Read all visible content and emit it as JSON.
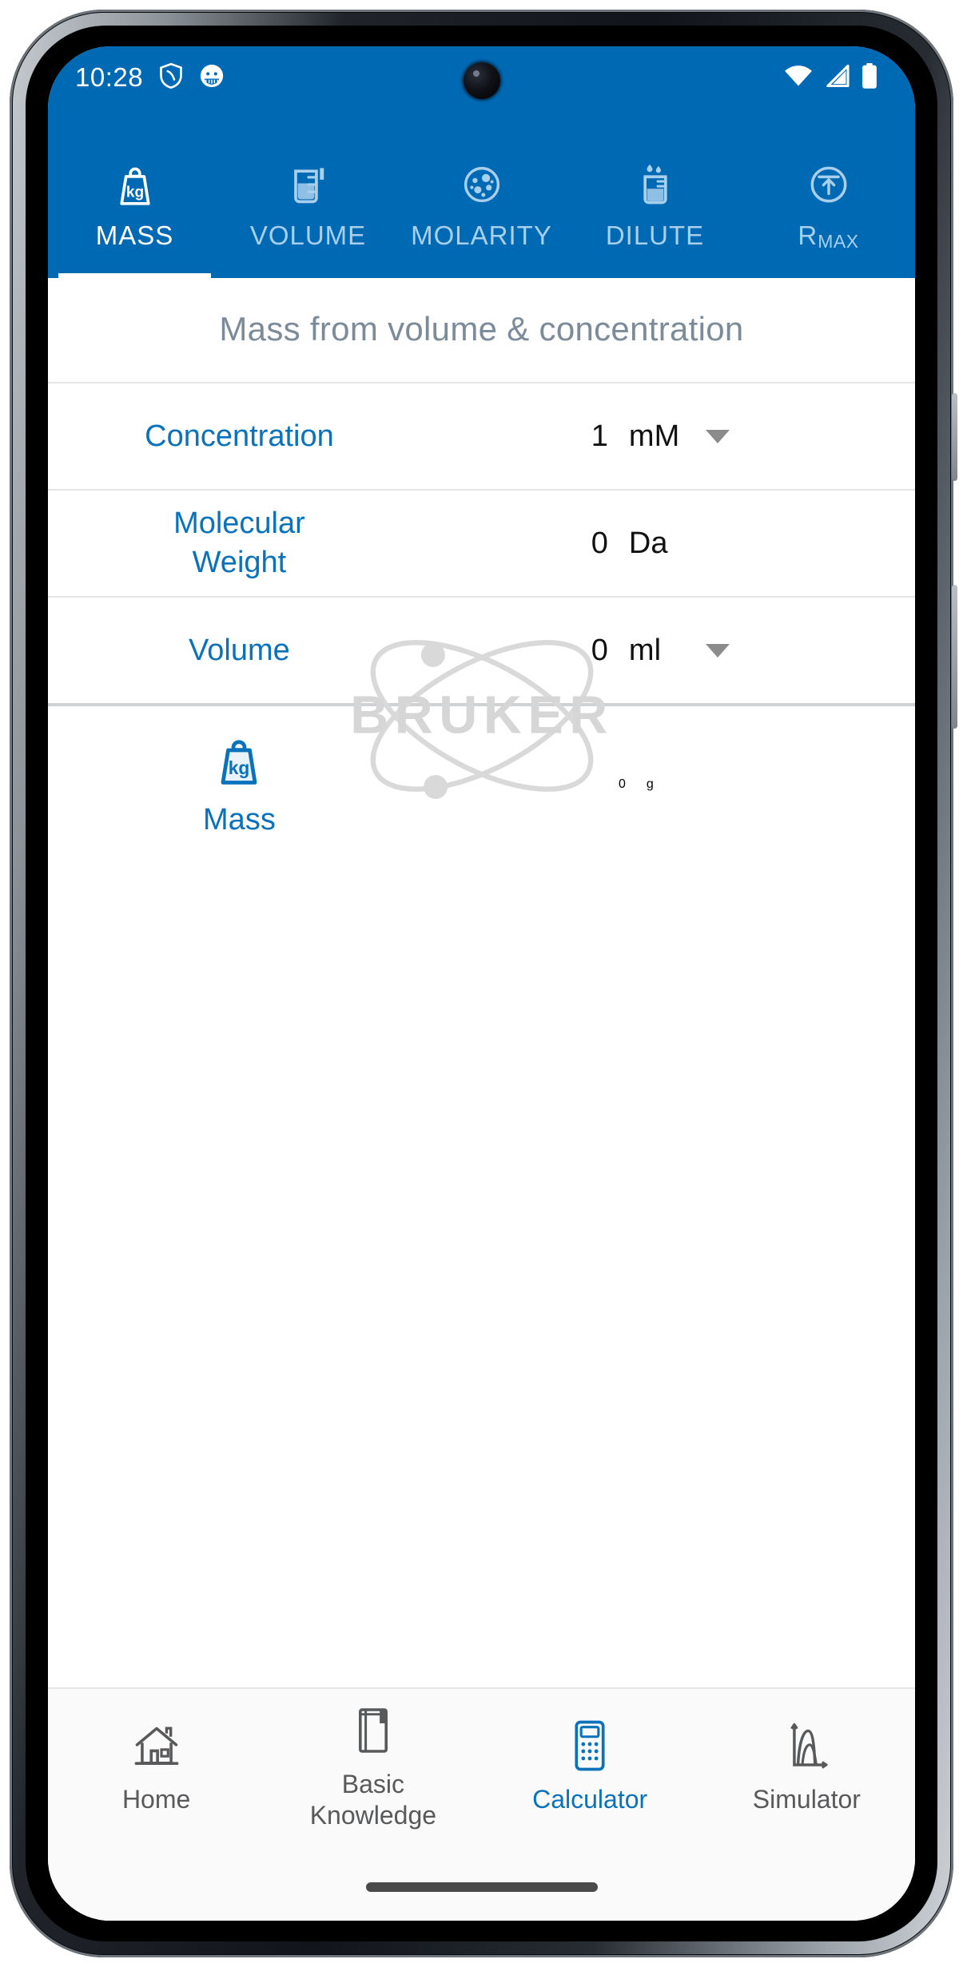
{
  "status_bar": {
    "time": "10:28",
    "left_icons": [
      "shield-icon",
      "app-notification-icon"
    ],
    "right_icons": [
      "wifi-icon",
      "cellular-signal-icon",
      "battery-icon"
    ],
    "background_color": "#0069b4"
  },
  "tabs": [
    {
      "label": "MASS",
      "icon": "weight-kg-icon",
      "active": true
    },
    {
      "label": "VOLUME",
      "icon": "beaker-icon",
      "active": false
    },
    {
      "label": "MOLARITY",
      "icon": "molecule-dots-icon",
      "active": false
    },
    {
      "label": "DILUTE",
      "icon": "dropper-beaker-icon",
      "active": false
    },
    {
      "label": "RMAX",
      "label_main": "R",
      "label_sub": "MAX",
      "icon": "rmax-arrow-circle-icon",
      "active": false
    }
  ],
  "main": {
    "screen_title": "Mass from volume & concentration",
    "rows": [
      {
        "label": "Concentration",
        "value": "1",
        "unit": "mM",
        "has_dropdown": true
      },
      {
        "label": "Molecular\nWeight",
        "label_line1": "Molecular",
        "label_line2": "Weight",
        "value": "0",
        "unit": "Da",
        "has_dropdown": false
      },
      {
        "label": "Volume",
        "value": "0",
        "unit": "ml",
        "has_dropdown": true
      }
    ],
    "result": {
      "icon": "weight-kg-icon",
      "label": "Mass",
      "value": "0",
      "unit": "g"
    },
    "watermark": {
      "text": "BRUKER",
      "icon": "atom-orbit-icon",
      "color": "#d8d8d8"
    }
  },
  "bottom_nav": [
    {
      "label": "Home",
      "icon": "house-icon",
      "active": false
    },
    {
      "label": "Basic\nKnowledge",
      "label_line1": "Basic",
      "label_line2": "Knowledge",
      "icon": "book-icon",
      "active": false
    },
    {
      "label": "Calculator",
      "icon": "calculator-icon",
      "active": true
    },
    {
      "label": "Simulator",
      "icon": "chart-curve-icon",
      "active": false
    }
  ],
  "colors": {
    "brand_blue": "#0069b4",
    "link_blue": "#0a72ba",
    "title_gray": "#7b8b99",
    "tab_inactive": "#a8cfec"
  }
}
